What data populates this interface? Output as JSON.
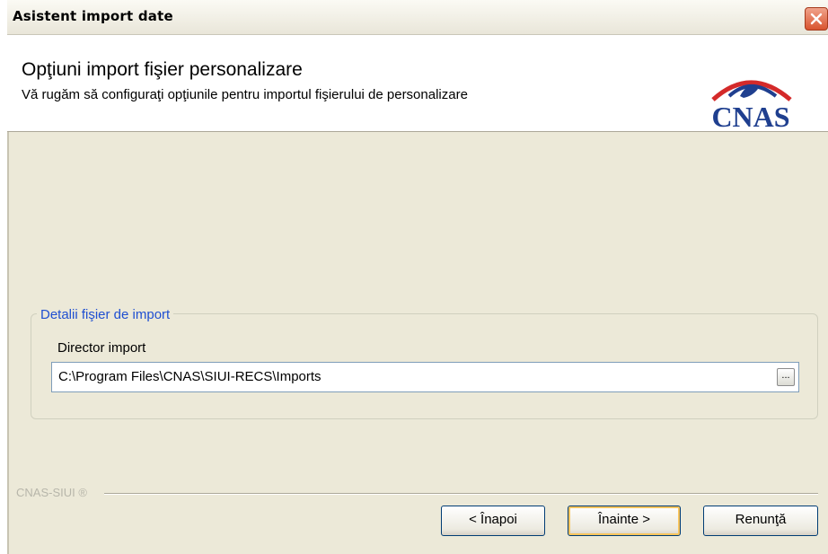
{
  "window": {
    "title": "Asistent import date"
  },
  "header": {
    "title": "Opţiuni import fişier personalizare",
    "subtitle": "Vă rugăm să configuraţi opţiunile pentru importul fişierului de personalizare",
    "logo_text": "CNAS"
  },
  "import_details": {
    "group_label": "Detalii fişier de import",
    "directory_label": "Director import",
    "directory_value": "C:\\Program Files\\CNAS\\SIUI-RECS\\Imports",
    "browse_label": "..."
  },
  "footer": {
    "brand": "CNAS-SIUI ®",
    "back_label": "< Înapoi",
    "next_label": "Înainte >",
    "cancel_label": "Renunţă"
  },
  "colors": {
    "body_bg": "#ece9d8",
    "group_label": "#1f4fd1",
    "logo_blue": "#1f3f8f",
    "logo_red": "#d42a2a"
  }
}
